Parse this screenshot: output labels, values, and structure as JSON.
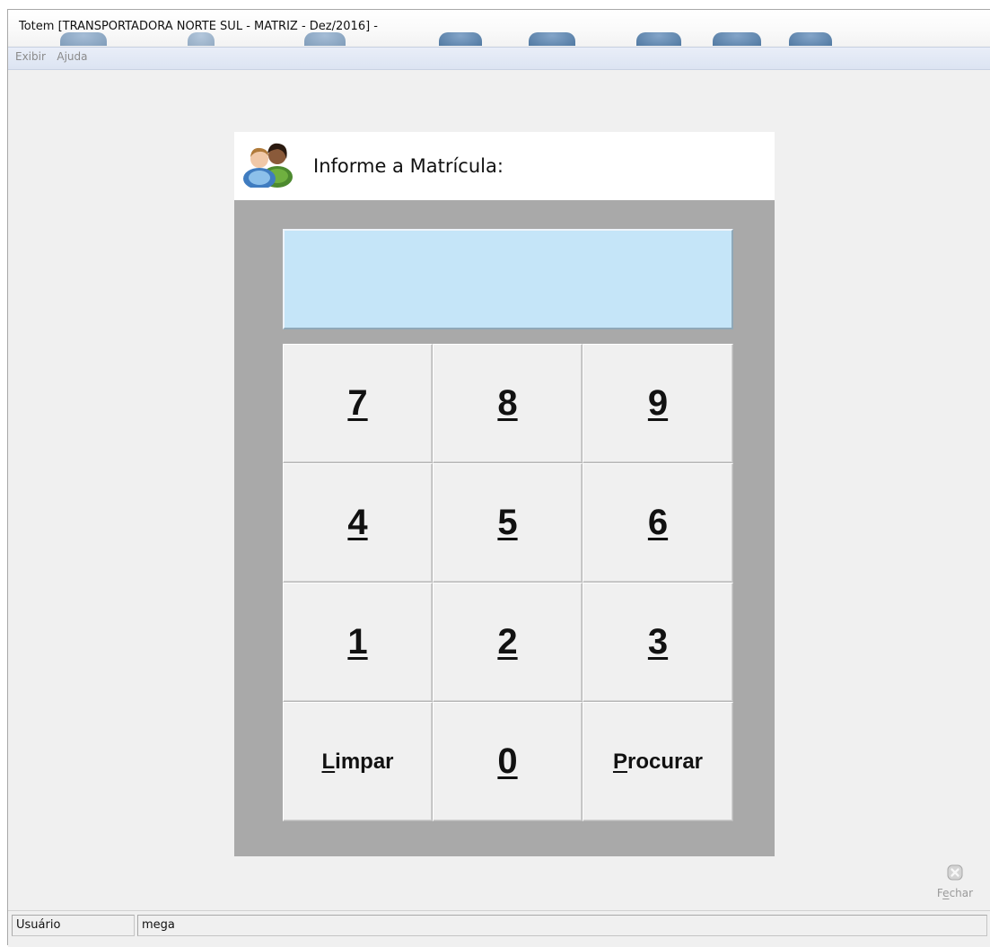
{
  "window": {
    "title": "Totem [TRANSPORTADORA NORTE SUL -  MATRIZ - Dez/2016]  -"
  },
  "menu": {
    "items": [
      {
        "label": "Exibir"
      },
      {
        "label": "Ajuda"
      }
    ]
  },
  "panel": {
    "prompt": "Informe a Matrícula:",
    "icon": "people-icon",
    "display_value": ""
  },
  "keypad": {
    "keys": [
      {
        "label": "7",
        "mnemonic": "7",
        "rest": "",
        "name": "key-7-button",
        "kind": "digit"
      },
      {
        "label": "8",
        "mnemonic": "8",
        "rest": "",
        "name": "key-8-button",
        "kind": "digit"
      },
      {
        "label": "9",
        "mnemonic": "9",
        "rest": "",
        "name": "key-9-button",
        "kind": "digit"
      },
      {
        "label": "4",
        "mnemonic": "4",
        "rest": "",
        "name": "key-4-button",
        "kind": "digit"
      },
      {
        "label": "5",
        "mnemonic": "5",
        "rest": "",
        "name": "key-5-button",
        "kind": "digit"
      },
      {
        "label": "6",
        "mnemonic": "6",
        "rest": "",
        "name": "key-6-button",
        "kind": "digit"
      },
      {
        "label": "1",
        "mnemonic": "1",
        "rest": "",
        "name": "key-1-button",
        "kind": "digit"
      },
      {
        "label": "2",
        "mnemonic": "2",
        "rest": "",
        "name": "key-2-button",
        "kind": "digit"
      },
      {
        "label": "3",
        "mnemonic": "3",
        "rest": "",
        "name": "key-3-button",
        "kind": "digit"
      },
      {
        "label": "Limpar",
        "mnemonic": "L",
        "rest": "impar",
        "name": "limpar-button",
        "kind": "word"
      },
      {
        "label": "0",
        "mnemonic": "0",
        "rest": "",
        "name": "key-0-button",
        "kind": "digit"
      },
      {
        "label": "Procurar",
        "mnemonic": "P",
        "rest": "rocurar",
        "name": "procurar-button",
        "kind": "word"
      }
    ]
  },
  "close": {
    "label_prefix": "F",
    "label_mnemonic": "e",
    "label_rest": "char",
    "icon": "close-icon"
  },
  "statusbar": {
    "user_label": "Usuário",
    "user_value": "mega"
  },
  "colors": {
    "display_bg": "#c5e5f8",
    "panel_bg": "#a9a9a9"
  }
}
